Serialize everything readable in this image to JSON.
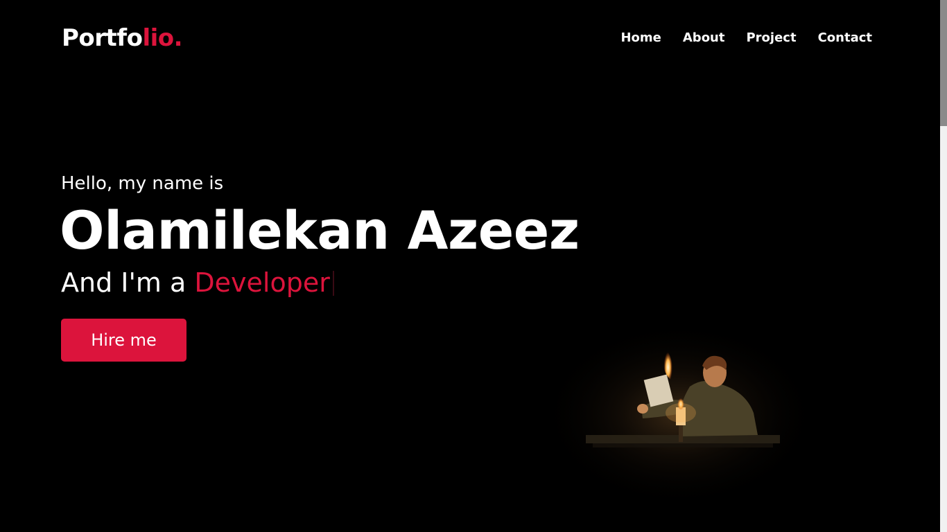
{
  "logo": {
    "text_main": "Portfo",
    "text_accent": "lio."
  },
  "nav": {
    "items": [
      {
        "label": "Home"
      },
      {
        "label": "About"
      },
      {
        "label": "Project"
      },
      {
        "label": "Contact"
      }
    ]
  },
  "hero": {
    "greeting": "Hello, my name is",
    "name": "Olamilekan Azeez",
    "role_prefix": "And I'm a ",
    "role": "Developer",
    "cta_label": "Hire me"
  },
  "colors": {
    "accent": "#dc143c",
    "background": "#000000",
    "text": "#ffffff"
  }
}
